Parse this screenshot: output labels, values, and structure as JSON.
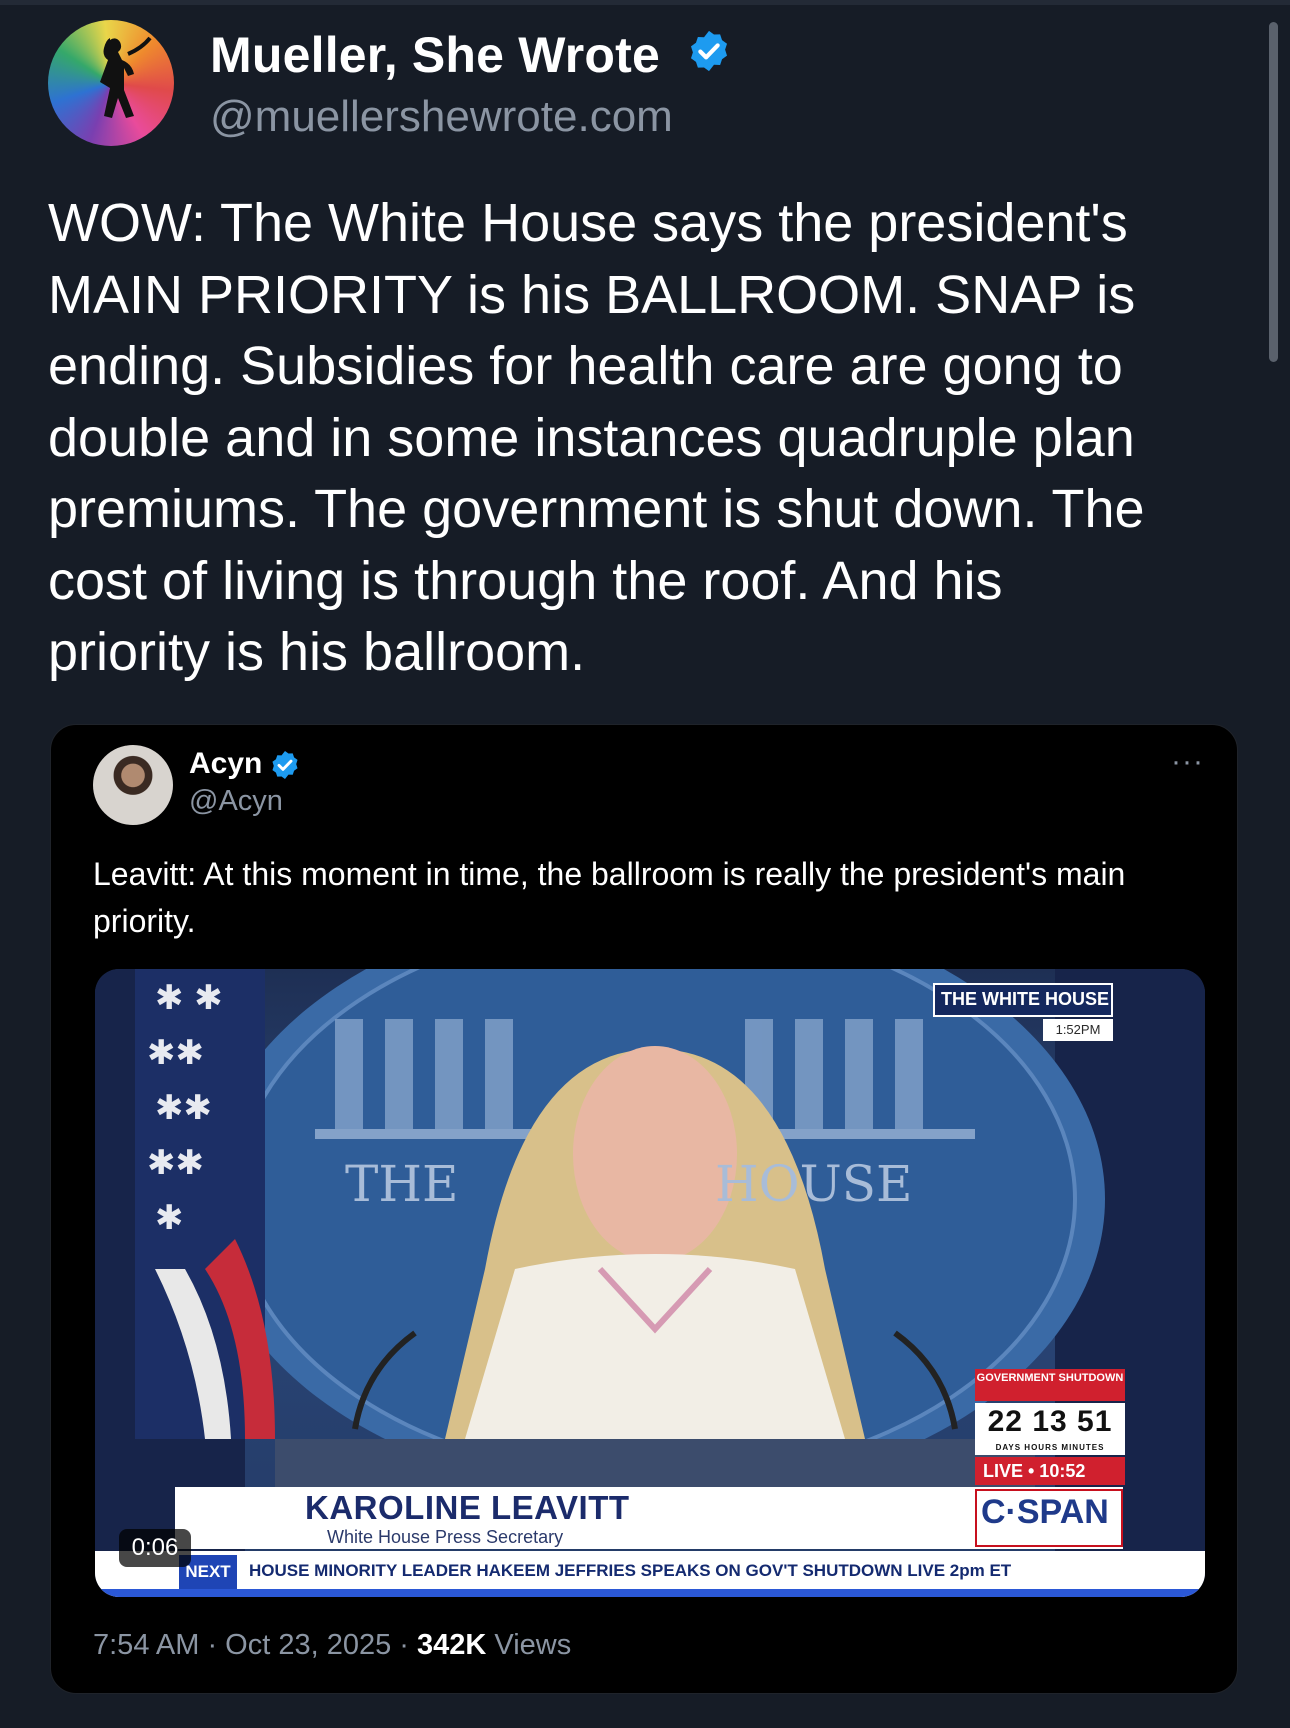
{
  "post": {
    "author_name": "Mueller, She Wrote",
    "author_handle": "@muellershewrote.com",
    "text": "WOW: The White House says the president's\nMAIN PRIORITY is his BALLROOM. SNAP is\nending. Subsidies for health care are gong to\ndouble and in some instances quadruple plan\npremiums. The government is shut down. The\ncost of living is through the roof. And his\npriority is his ballroom."
  },
  "quote": {
    "author_name": "Acyn",
    "author_handle": "@Acyn",
    "more_label": "···",
    "text": "Leavitt: At this moment in time, the ballroom is really the president's main priority.",
    "timestamp": "7:54 AM · Oct 23, 2025 · ",
    "views_count": "342K",
    "views_label": " Views"
  },
  "video": {
    "duration": "0:06",
    "wh_tag": "THE WHITE HOUSE",
    "wh_time": "1:52PM",
    "backdrop_left": "THE",
    "backdrop_right": "HOUSE",
    "speaker_name": "KAROLINE LEAVITT",
    "speaker_title": "White House Press Secretary",
    "network": "C·SPAN",
    "shutdown_label": "GOVERNMENT SHUTDOWN",
    "shutdown_count": "22 13 51",
    "shutdown_units": "DAYS HOURS MINUTES",
    "live_label": "LIVE • 10:52",
    "ticker_prefix": "NEXT",
    "ticker_text": "HOUSE MINORITY LEADER HAKEEM JEFFRIES SPEAKS ON GOV'T SHUTDOWN  LIVE 2pm ET"
  },
  "colors": {
    "background": "#161c26",
    "verified": "#1d9bf0",
    "secondary_text": "#8b95a3",
    "card": "#000000"
  },
  "icons": [
    "verified-badge-icon",
    "more-options-icon"
  ]
}
